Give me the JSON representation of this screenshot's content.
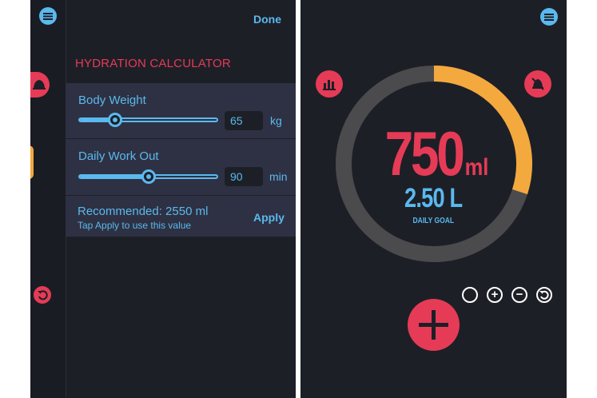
{
  "colors": {
    "background": "#1d1f27",
    "panel": "#2e3143",
    "accent_blue": "#5ab9ee",
    "accent_red": "#e63b56",
    "progress_orange": "#f3a93e",
    "ring_track": "#4b4b4d"
  },
  "calculator": {
    "done_label": "Done",
    "title": "HYDRATION CALCULATOR",
    "body_weight": {
      "label": "Body Weight",
      "value": "65",
      "unit": "kg",
      "slider_fraction": 0.26
    },
    "daily_workout": {
      "label": "Daily Work Out",
      "value": "90",
      "unit": "min",
      "slider_fraction": 0.5
    },
    "recommended": {
      "text": "Recommended: 2550 ml",
      "hint": "Tap Apply to use this value",
      "apply_label": "Apply"
    }
  },
  "tracker": {
    "intake_value": "750",
    "intake_unit": "ml",
    "goal_value": "2.50 L",
    "goal_caption": "DAILY GOAL",
    "progress_fraction": 0.3,
    "controls": {
      "add_symbol": "+",
      "remove_symbol": "−"
    }
  },
  "icons": {
    "menu": "menu-icon",
    "stats": "bar-chart-icon",
    "muted_bell": "bell-off-icon",
    "bell": "bell-icon",
    "undo": "undo-icon",
    "add": "plus-icon"
  }
}
